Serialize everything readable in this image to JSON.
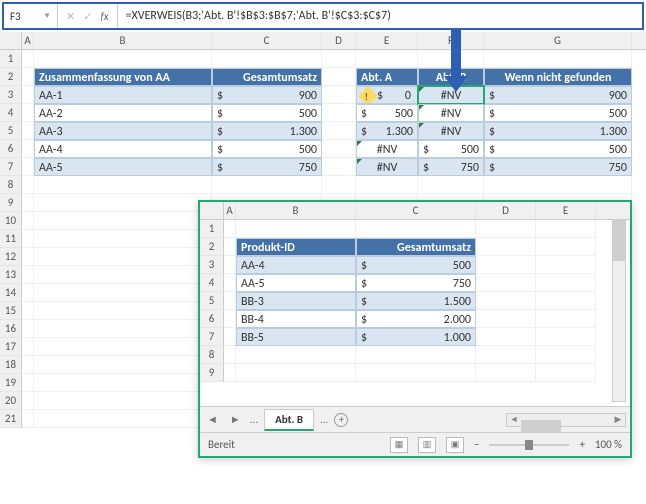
{
  "nameBox": "F3",
  "formula": "=XVERWEIS(B3;'Abt. B'!$B$3:$B$7;'Abt. B'!$C$3:$C$7)",
  "cols": [
    "A",
    "B",
    "C",
    "D",
    "E",
    "F",
    "G"
  ],
  "rowsMain": [
    "1",
    "2",
    "3",
    "4",
    "5",
    "6",
    "7",
    "8",
    "9",
    "10",
    "11",
    "12",
    "13",
    "14",
    "15",
    "16",
    "17",
    "18",
    "19",
    "20",
    "21"
  ],
  "tableMain": {
    "h1": "Zusammenfassung von AA",
    "h2": "Gesamtumsatz",
    "rows": [
      {
        "id": "AA-1",
        "cur": "$",
        "val": "900"
      },
      {
        "id": "AA-2",
        "cur": "$",
        "val": "500"
      },
      {
        "id": "AA-3",
        "cur": "$",
        "val": "1.300"
      },
      {
        "id": "AA-4",
        "cur": "$",
        "val": "500"
      },
      {
        "id": "AA-5",
        "cur": "$",
        "val": "750"
      }
    ]
  },
  "tableRight": {
    "h1": "Abt. A",
    "h2": "Abt. B",
    "h3": "Wenn nicht gefunden",
    "rows": [
      {
        "a_cur": "$",
        "a_val": "0",
        "warn": true,
        "b_val": "#NV",
        "b_cur": "",
        "g_cur": "$",
        "g_val": "900"
      },
      {
        "a_cur": "$",
        "a_val": "500",
        "b_val": "#NV",
        "b_cur": "",
        "g_cur": "$",
        "g_val": "500"
      },
      {
        "a_cur": "$",
        "a_val": "1.300",
        "b_val": "#NV",
        "b_cur": "",
        "g_cur": "$",
        "g_val": "1.300"
      },
      {
        "a_cur": "",
        "a_val": "#NV",
        "b_cur": "$",
        "b_val": "500",
        "g_cur": "$",
        "g_val": "500"
      },
      {
        "a_cur": "",
        "a_val": "#NV",
        "b_cur": "$",
        "b_val": "750",
        "g_cur": "$",
        "g_val": "750"
      }
    ]
  },
  "inset": {
    "cols": [
      "A",
      "B",
      "C",
      "D",
      "E"
    ],
    "rows": [
      "1",
      "2",
      "3",
      "4",
      "5",
      "6",
      "7",
      "8",
      "9"
    ],
    "h1": "Produkt-ID",
    "h2": "Gesamtumsatz",
    "data": [
      {
        "id": "AA-4",
        "cur": "$",
        "val": "500"
      },
      {
        "id": "AA-5",
        "cur": "$",
        "val": "750"
      },
      {
        "id": "BB-3",
        "cur": "$",
        "val": "1.500"
      },
      {
        "id": "BB-4",
        "cur": "$",
        "val": "2.000"
      },
      {
        "id": "BB-5",
        "cur": "$",
        "val": "1.000"
      }
    ],
    "tab": "Abt. B",
    "ellipsis": "...",
    "status": "Bereit",
    "zoom": "100 %"
  }
}
